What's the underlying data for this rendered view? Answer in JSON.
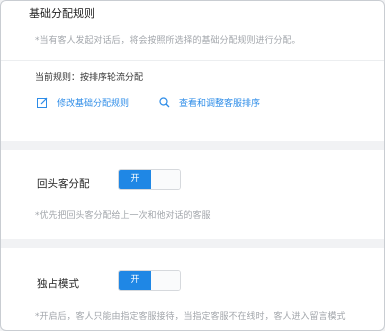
{
  "basic_rule": {
    "title": "基础分配规则",
    "description": "*当有客人发起对话后，将会按照所选择的基础分配规则进行分配。",
    "current_rule": "当前规则：按排序轮流分配",
    "edit_link": "修改基础分配规则",
    "view_link": "查看和调整客服排序"
  },
  "returning_customer": {
    "label": "回头客分配",
    "toggle_label": "开",
    "enabled": true,
    "description": "*优先把回头客分配给上一次和他对话的客服"
  },
  "exclusive_mode": {
    "label": "独占模式",
    "toggle_label": "开",
    "enabled": true,
    "description": "*开启后，客人只能由指定客服接待，当指定客服不在线时，客人进入留言模式"
  },
  "colors": {
    "accent": "#1f87e5",
    "link": "#2d8ce8",
    "background": "#f1f2f4"
  },
  "icons": {
    "edit": "edit-icon",
    "search": "search-icon"
  }
}
